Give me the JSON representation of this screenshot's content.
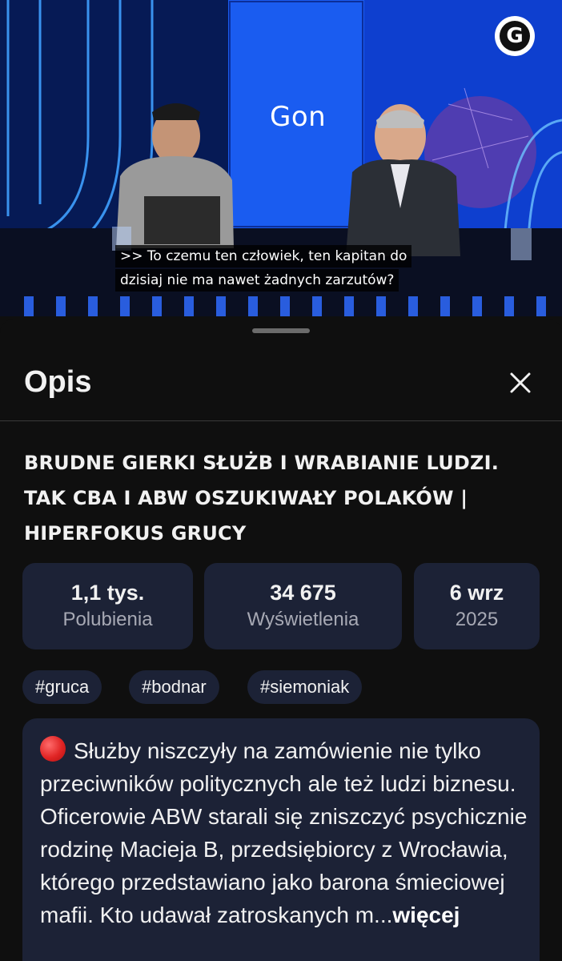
{
  "video": {
    "brand_name": "Gon",
    "logo_letter": "G",
    "subtitle_line1": ">> To czemu ten człowiek, ten kapitan do",
    "subtitle_line2": "dzisiaj nie ma nawet żadnych zarzutów?"
  },
  "sheet": {
    "title": "Opis",
    "close_icon": "close-icon"
  },
  "video_title": "BRUDNE GIERKI SŁUŻB I WRABIANIE LUDZI. TAK CBA I ABW OSZUKIWAŁY POLAKÓW | HIPERFOKUS GRUCY",
  "stats": [
    {
      "value": "1,1 tys.",
      "label": "Polubienia"
    },
    {
      "value": "34 675",
      "label": "Wyświetlenia"
    },
    {
      "value": "6 wrz",
      "label": "2025"
    }
  ],
  "tags": [
    "#gruca",
    "#bodnar",
    "#siemoniak"
  ],
  "description": {
    "icon": "red-circle-icon",
    "text": "Służby niszczyły na zamówienie nie tylko przeciwników politycznych ale też ludzi biznesu. Oficerowie ABW starali się zniszczyć psychicznie rodzinę Macieja B, przedsiębiorcy z Wrocławia, którego przedstawiano jako barona śmieciowej mafii. Kto udawał zatroskanych m...",
    "more_label": "więcej"
  },
  "colors": {
    "background": "#0f0f0f",
    "card": "#1c2236",
    "muted_text": "#a7a9b4",
    "divider": "#3a3a3a"
  }
}
